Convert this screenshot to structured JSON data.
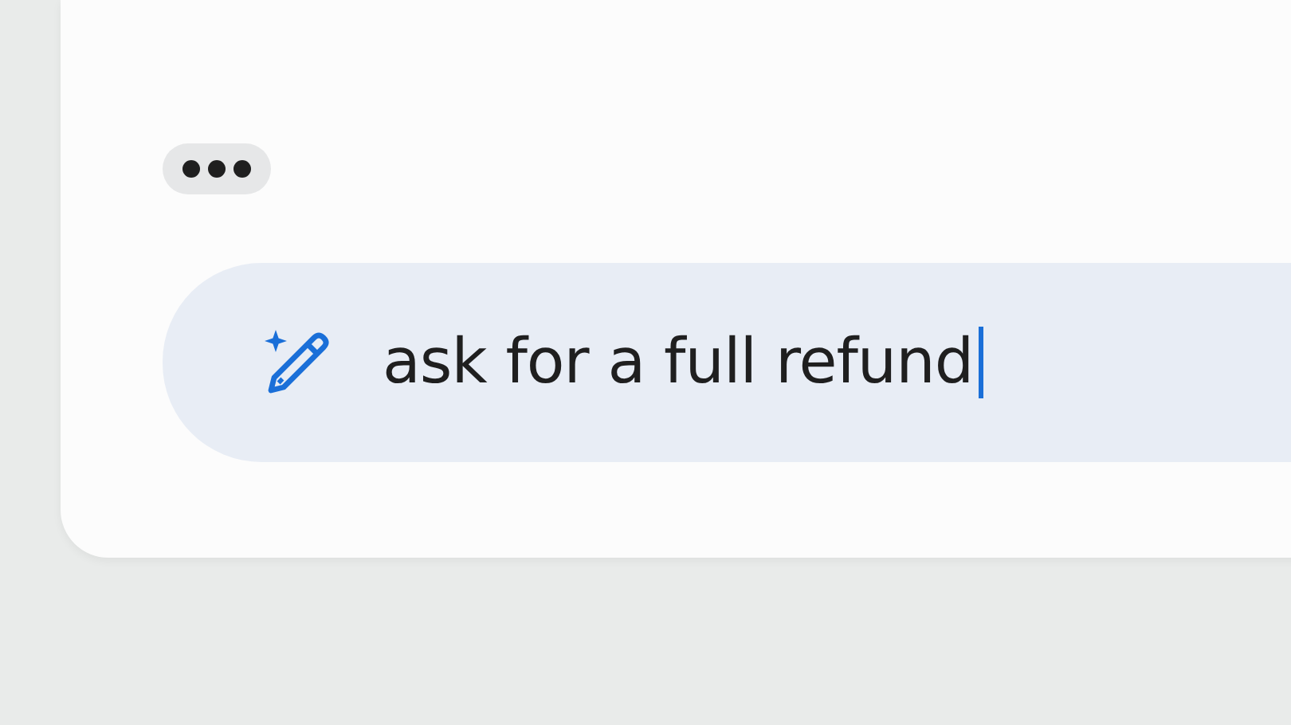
{
  "composer": {
    "value": "ask for a full refund",
    "focused": true
  }
}
